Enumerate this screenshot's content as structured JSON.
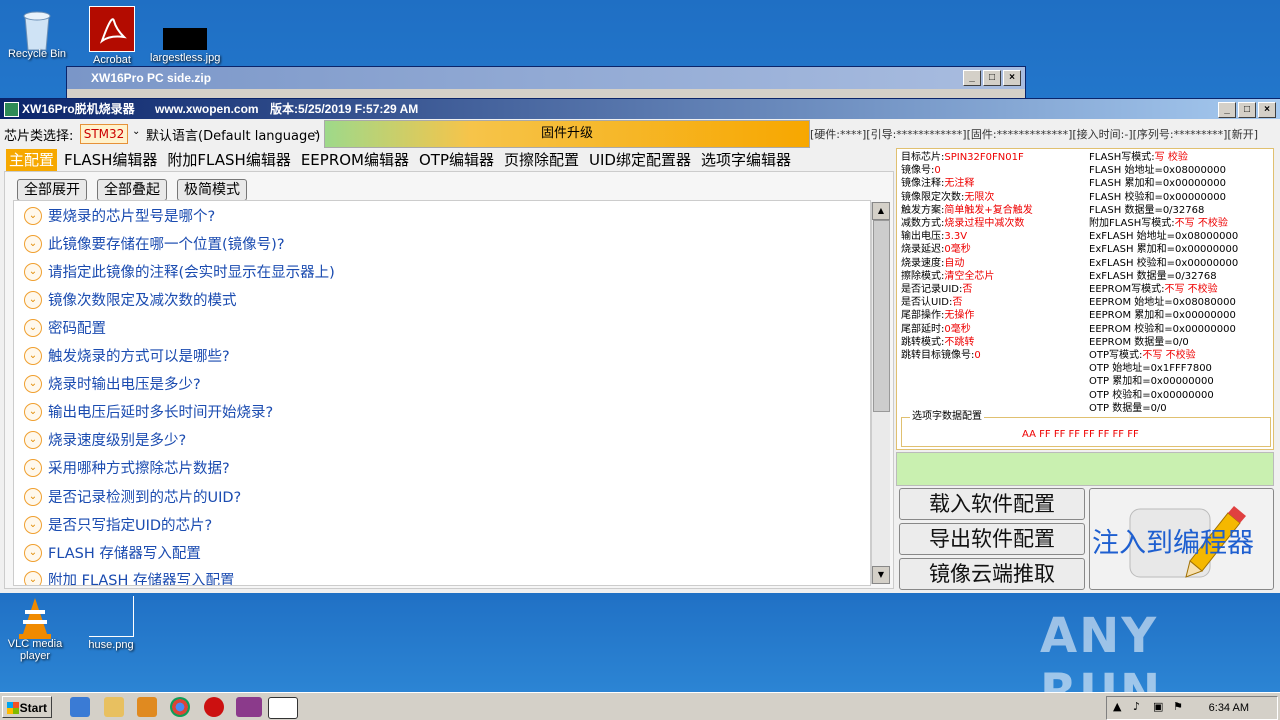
{
  "desktop": {
    "icons": [
      {
        "label": "Recycle Bin"
      },
      {
        "label": "Acrobat"
      },
      {
        "label": "largestless.jpg"
      },
      {
        "label": "VLC media player"
      },
      {
        "label": "huse.png"
      }
    ],
    "watermark": "ANY RUN"
  },
  "background_window": {
    "title": "XW16Pro PC side.zip"
  },
  "app": {
    "title": "XW16Pro脱机烧录器",
    "website": "www.xwopen.com",
    "version": "版本:5/25/2019 F:57:29 AM",
    "chip_type_label": "芯片类选择:",
    "chip_type_value": "STM32",
    "language": "默认语言(Default language)",
    "firmware_button": "固件升级",
    "hw_info": "[硬件:****][引导:************][固件:*************][接入时间:-][序列号:*********][新开]",
    "tabs": [
      "主配置",
      "FLASH编辑器",
      "附加FLASH编辑器",
      "EEPROM编辑器",
      "OTP编辑器",
      "页擦除配置",
      "UID绑定配置器",
      "选项字编辑器"
    ],
    "buttons": {
      "expand_all": "全部展开",
      "collapse_all": "全部叠起",
      "minimal_mode": "极简模式"
    },
    "questions": [
      "要烧录的芯片型号是哪个?",
      "此镜像要存储在哪一个位置(镜像号)?",
      "请指定此镜像的注释(会实时显示在显示器上)",
      "镜像次数限定及减次数的模式",
      "密码配置",
      "触发烧录的方式可以是哪些?",
      "烧录时输出电压是多少?",
      "输出电压后延时多长时间开始烧录?",
      "烧录速度级别是多少?",
      "采用哪种方式擦除芯片数据?",
      "是否记录检测到的芯片的UID?",
      "是否只写指定UID的芯片?",
      "FLASH 存储器写入配置",
      "附加 FLASH 存储器写入配置"
    ],
    "info_left": [
      {
        "k": "目标芯片:",
        "v": "SPIN32F0FN01F"
      },
      {
        "k": "镜像号:",
        "v": "0"
      },
      {
        "k": "镜像注释:",
        "v": "无注释"
      },
      {
        "k": "镜像限定次数:",
        "v": "无限次"
      },
      {
        "k": "触发方案:",
        "v": "简单触发+复合触发"
      },
      {
        "k": "减数方式:",
        "v": "烧录过程中减次数"
      },
      {
        "k": "输出电压:",
        "v": "3.3V"
      },
      {
        "k": "烧录延迟:",
        "v": "0毫秒"
      },
      {
        "k": "烧录速度:",
        "v": "自动"
      },
      {
        "k": "擦除模式:",
        "v": "清空全芯片"
      },
      {
        "k": "是否记录UID:",
        "v": "否"
      },
      {
        "k": "是否认UID:",
        "v": "否"
      },
      {
        "k": "尾部操作:",
        "v": "无操作"
      },
      {
        "k": "尾部延时:",
        "v": "0毫秒"
      },
      {
        "k": "跳转模式:",
        "v": "不跳转"
      },
      {
        "k": "跳转目标镜像号:",
        "v": "0"
      }
    ],
    "info_right": [
      {
        "k": "FLASH写模式:",
        "v": "写 校验"
      },
      {
        "k": "FLASH 始地址=0x08000000",
        "v": ""
      },
      {
        "k": "FLASH 累加和=0x00000000",
        "v": ""
      },
      {
        "k": "FLASH 校验和=0x00000000",
        "v": ""
      },
      {
        "k": "FLASH 数据量=0/32768",
        "v": ""
      },
      {
        "k": "附加FLASH写模式:",
        "v": "不写 不校验"
      },
      {
        "k": "ExFLASH 始地址=0x08000000",
        "v": ""
      },
      {
        "k": "ExFLASH 累加和=0x00000000",
        "v": ""
      },
      {
        "k": "ExFLASH 校验和=0x00000000",
        "v": ""
      },
      {
        "k": "ExFLASH 数据量=0/32768",
        "v": ""
      },
      {
        "k": "EEPROM写模式:",
        "v": "不写 不校验"
      },
      {
        "k": "EEPROM 始地址=0x08080000",
        "v": ""
      },
      {
        "k": "EEPROM 累加和=0x00000000",
        "v": ""
      },
      {
        "k": "EEPROM 校验和=0x00000000",
        "v": ""
      },
      {
        "k": "EEPROM 数据量=0/0",
        "v": ""
      },
      {
        "k": "OTP写模式:",
        "v": "不写 不校验"
      },
      {
        "k": "OTP 始地址=0x1FFF7800",
        "v": ""
      },
      {
        "k": "OTP 累加和=0x00000000",
        "v": ""
      },
      {
        "k": "OTP 校验和=0x00000000",
        "v": ""
      },
      {
        "k": "OTP 数据量=0/0",
        "v": ""
      }
    ],
    "option_bytes_label": "选项字数据配置",
    "option_bytes_value": "AA FF FF FF FF FF FF FF",
    "load_config": "载入软件配置",
    "export_config": "导出软件配置",
    "cloud_fetch": "镜像云端推取",
    "inject": "注入到编程器"
  },
  "taskbar": {
    "start": "Start",
    "clock": "6:34 AM"
  },
  "colors": {
    "accent_orange": "#f6a800",
    "value_red": "#e00000",
    "link_blue": "#1a4bb0",
    "inject_blue": "#1e5fd0"
  }
}
